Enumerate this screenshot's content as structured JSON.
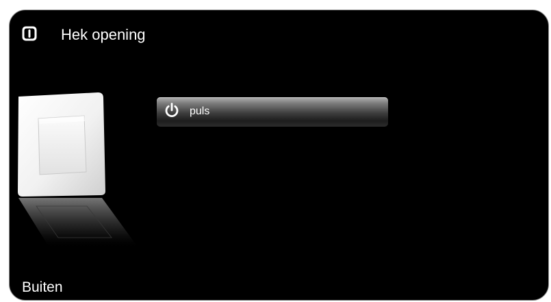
{
  "header": {
    "title": "Hek opening",
    "icon": "switch-device-icon"
  },
  "device_image": {
    "icon": "wall-switch-image"
  },
  "actions": [
    {
      "label": "puls",
      "icon": "power-icon"
    }
  ],
  "footer": {
    "location": "Buiten"
  },
  "colors": {
    "background": "#000000",
    "text": "#ffffff",
    "button_top": "#b2b2b2",
    "button_bottom": "#1d1d1d"
  }
}
